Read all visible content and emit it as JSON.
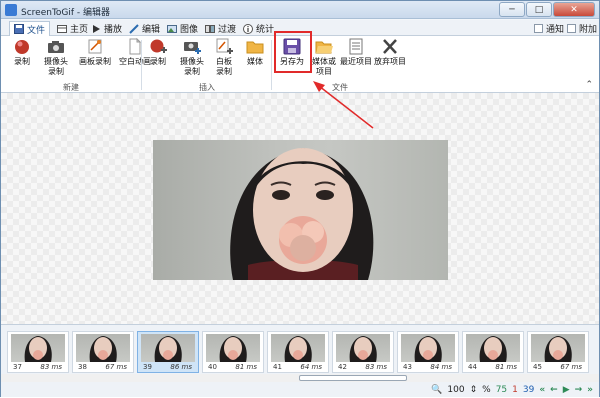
{
  "window": {
    "title": "ScreenToGif - 编辑器",
    "controls": [
      "─",
      "□",
      "✕"
    ]
  },
  "tabs": [
    {
      "label": "文件",
      "icon": "save-icon",
      "active": true
    },
    {
      "label": "主页",
      "icon": "home-icon"
    },
    {
      "label": "播放",
      "icon": "play-icon"
    },
    {
      "label": "编辑",
      "icon": "pencil-icon"
    },
    {
      "label": "图像",
      "icon": "image-icon"
    },
    {
      "label": "过渡",
      "icon": "transition-icon"
    },
    {
      "label": "统计",
      "icon": "info-icon"
    }
  ],
  "tab_options": {
    "notify": "通知",
    "extra": "附加"
  },
  "ribbon": {
    "groups": [
      {
        "label": "新建",
        "buttons": [
          {
            "label": "录制",
            "icon": "record-icon"
          },
          {
            "label": "摄像头\n录制",
            "icon": "camera-icon"
          },
          {
            "label": "画板录制",
            "icon": "board-icon"
          },
          {
            "label": "空白动画",
            "icon": "blank-file-icon"
          }
        ]
      },
      {
        "label": "插入",
        "buttons": [
          {
            "label": "录制",
            "icon": "record-add-icon"
          },
          {
            "label": "摄像头\n录制",
            "icon": "camera-add-icon"
          },
          {
            "label": "白板\n录制",
            "icon": "board-add-icon"
          },
          {
            "label": "媒体",
            "icon": "folder-icon"
          }
        ]
      },
      {
        "label": "文件",
        "buttons": [
          {
            "label": "另存为",
            "icon": "save-as-icon"
          },
          {
            "label": "媒体或\n项目",
            "icon": "open-folder-icon"
          },
          {
            "label": "最近项目",
            "icon": "recent-icon"
          },
          {
            "label": "放弃项目",
            "icon": "discard-icon"
          }
        ]
      }
    ]
  },
  "frames": [
    {
      "index": "37",
      "delay": "83 ms"
    },
    {
      "index": "38",
      "delay": "67 ms"
    },
    {
      "index": "39",
      "delay": "86 ms",
      "selected": true
    },
    {
      "index": "40",
      "delay": "81 ms"
    },
    {
      "index": "41",
      "delay": "64 ms"
    },
    {
      "index": "42",
      "delay": "83 ms"
    },
    {
      "index": "43",
      "delay": "84 ms"
    },
    {
      "index": "44",
      "delay": "81 ms"
    },
    {
      "index": "45",
      "delay": "67 ms"
    }
  ],
  "status": {
    "zoom": "100",
    "zoom_unit": "%",
    "frame_count": "75",
    "selected_count": "1",
    "current_frame": "39"
  },
  "colors": {
    "accent": "#1c4f8c",
    "highlight": "#e12a2a",
    "count_green": "#2e8b57",
    "count_red": "#c0392b",
    "count_blue": "#1f5fb0"
  }
}
